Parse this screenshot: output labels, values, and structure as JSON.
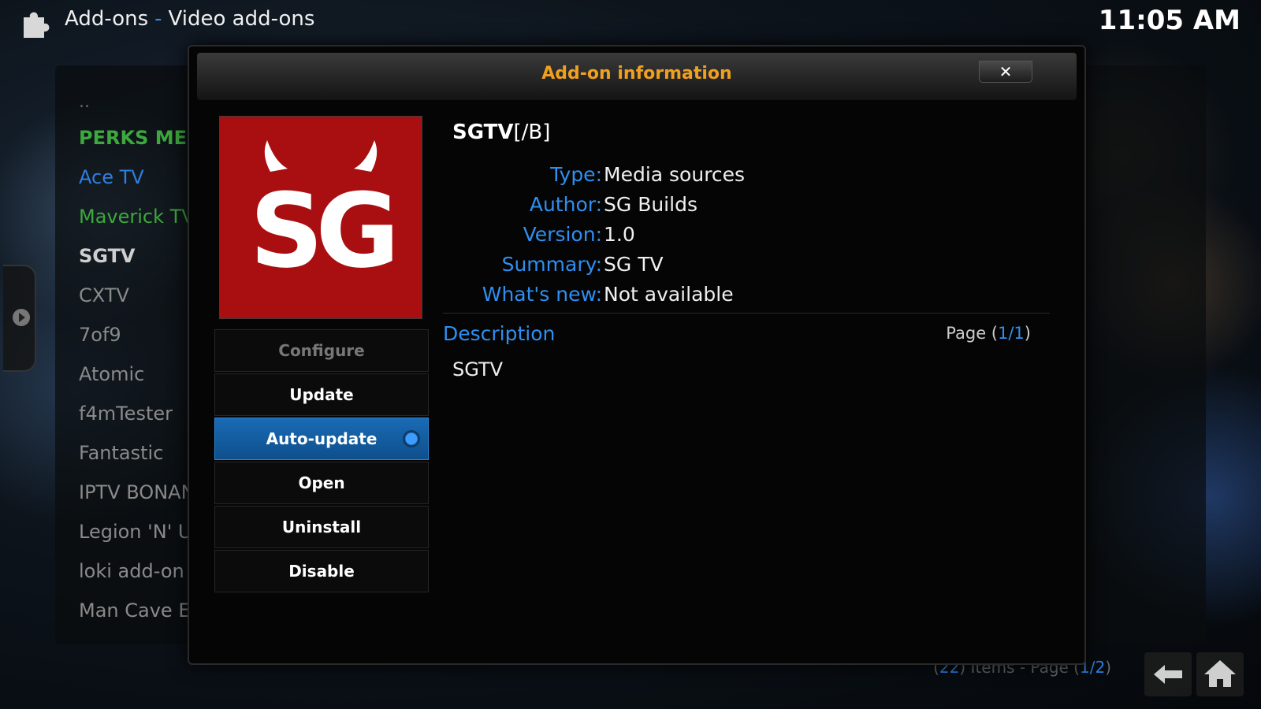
{
  "header": {
    "section": "Add-ons",
    "category": "Video add-ons",
    "time": "11:05 AM"
  },
  "addon_list": [
    "..",
    "PERKS MED",
    "Ace TV",
    "Maverick TV",
    "SGTV",
    "CXTV",
    "7of9",
    "Atomic",
    "f4mTester",
    "Fantastic",
    "IPTV BONAN",
    "Legion 'N' Ur",
    "loki add-on",
    "Man Cave Er"
  ],
  "footer": {
    "count": "22",
    "items_text": "Items - Page",
    "page": "1/2"
  },
  "dialog": {
    "title": "Add-on information",
    "close_label": "✕",
    "addon": {
      "name_bold": "SGTV",
      "name_rest": "[/B]",
      "logo_text": "SG"
    },
    "fields": [
      {
        "label": "Type:",
        "value": "Media sources"
      },
      {
        "label": "Author:",
        "value": "SG Builds"
      },
      {
        "label": "Version:",
        "value": "1.0"
      },
      {
        "label": "Summary:",
        "value": "SG TV"
      },
      {
        "label": "What's new:",
        "value": "Not available"
      }
    ],
    "description_label": "Description",
    "page_prefix": "Page",
    "page_value": "1/1",
    "description": "SGTV",
    "buttons": {
      "configure": "Configure",
      "update": "Update",
      "auto_update": "Auto-update",
      "open": "Open",
      "uninstall": "Uninstall",
      "disable": "Disable"
    }
  },
  "colors": {
    "accent_blue": "#2f8ff0",
    "title_orange": "#f0a020",
    "logo_red": "#a90f10"
  }
}
